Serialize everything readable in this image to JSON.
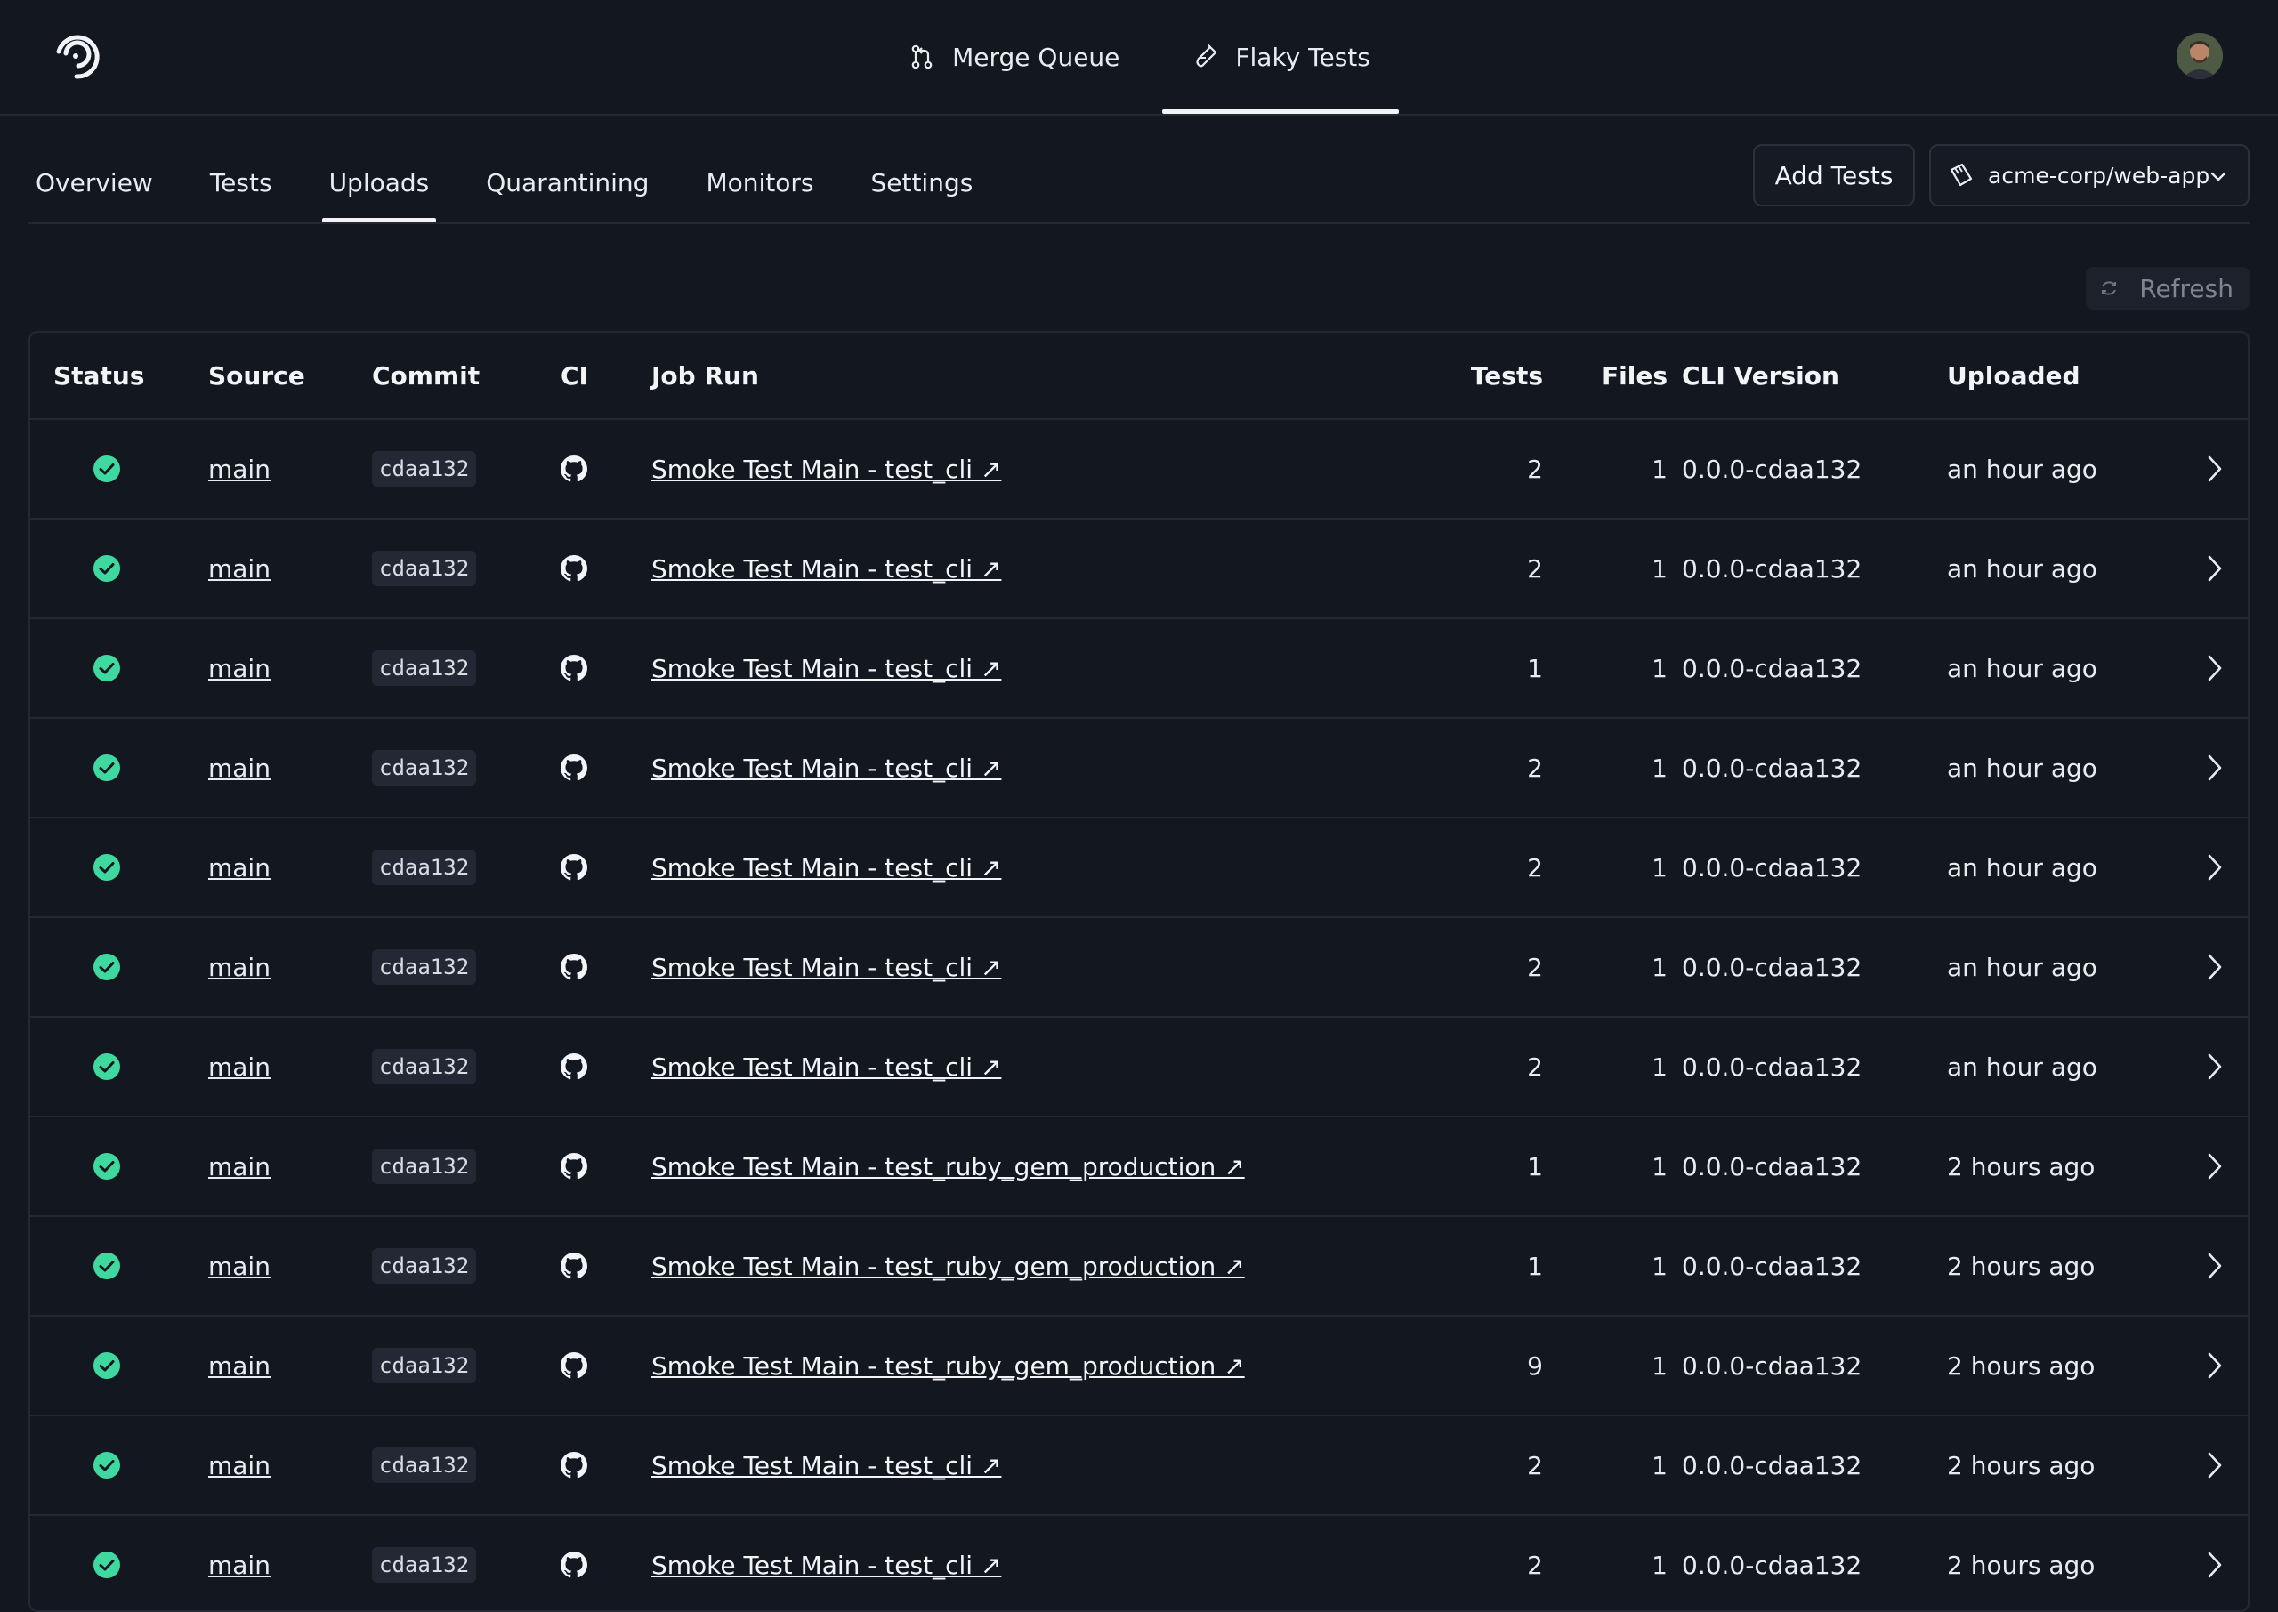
{
  "topnav": {
    "items": [
      {
        "label": "Merge Queue",
        "icon": "merge-icon",
        "active": false
      },
      {
        "label": "Flaky Tests",
        "icon": "test-tube-icon",
        "active": true
      }
    ]
  },
  "subnav": {
    "tabs": [
      {
        "label": "Overview"
      },
      {
        "label": "Tests"
      },
      {
        "label": "Uploads"
      },
      {
        "label": "Quarantining"
      },
      {
        "label": "Monitors"
      },
      {
        "label": "Settings"
      }
    ],
    "active_tab": "Uploads",
    "add_tests_label": "Add Tests",
    "repo_label": "acme-corp/web-app"
  },
  "refresh_label": "Refresh",
  "table": {
    "headers": {
      "status": "Status",
      "source": "Source",
      "commit": "Commit",
      "ci": "CI",
      "job_run": "Job Run",
      "tests": "Tests",
      "files": "Files",
      "cli_version": "CLI Version",
      "uploaded": "Uploaded"
    },
    "rows": [
      {
        "source": "main",
        "commit": "cdaa132",
        "job_run": "Smoke Test Main - test_cli ↗",
        "tests": "2",
        "files": "1",
        "cli_version": "0.0.0-cdaa132",
        "uploaded": "an hour ago"
      },
      {
        "source": "main",
        "commit": "cdaa132",
        "job_run": "Smoke Test Main - test_cli ↗",
        "tests": "2",
        "files": "1",
        "cli_version": "0.0.0-cdaa132",
        "uploaded": "an hour ago"
      },
      {
        "source": "main",
        "commit": "cdaa132",
        "job_run": "Smoke Test Main - test_cli ↗",
        "tests": "1",
        "files": "1",
        "cli_version": "0.0.0-cdaa132",
        "uploaded": "an hour ago"
      },
      {
        "source": "main",
        "commit": "cdaa132",
        "job_run": "Smoke Test Main - test_cli ↗",
        "tests": "2",
        "files": "1",
        "cli_version": "0.0.0-cdaa132",
        "uploaded": "an hour ago"
      },
      {
        "source": "main",
        "commit": "cdaa132",
        "job_run": "Smoke Test Main - test_cli ↗",
        "tests": "2",
        "files": "1",
        "cli_version": "0.0.0-cdaa132",
        "uploaded": "an hour ago"
      },
      {
        "source": "main",
        "commit": "cdaa132",
        "job_run": "Smoke Test Main - test_cli ↗",
        "tests": "2",
        "files": "1",
        "cli_version": "0.0.0-cdaa132",
        "uploaded": "an hour ago"
      },
      {
        "source": "main",
        "commit": "cdaa132",
        "job_run": "Smoke Test Main - test_cli ↗",
        "tests": "2",
        "files": "1",
        "cli_version": "0.0.0-cdaa132",
        "uploaded": "an hour ago"
      },
      {
        "source": "main",
        "commit": "cdaa132",
        "job_run": "Smoke Test Main - test_ruby_gem_production ↗",
        "tests": "1",
        "files": "1",
        "cli_version": "0.0.0-cdaa132",
        "uploaded": "2 hours ago"
      },
      {
        "source": "main",
        "commit": "cdaa132",
        "job_run": "Smoke Test Main - test_ruby_gem_production ↗",
        "tests": "1",
        "files": "1",
        "cli_version": "0.0.0-cdaa132",
        "uploaded": "2 hours ago"
      },
      {
        "source": "main",
        "commit": "cdaa132",
        "job_run": "Smoke Test Main - test_ruby_gem_production ↗",
        "tests": "9",
        "files": "1",
        "cli_version": "0.0.0-cdaa132",
        "uploaded": "2 hours ago"
      },
      {
        "source": "main",
        "commit": "cdaa132",
        "job_run": "Smoke Test Main - test_cli ↗",
        "tests": "2",
        "files": "1",
        "cli_version": "0.0.0-cdaa132",
        "uploaded": "2 hours ago"
      },
      {
        "source": "main",
        "commit": "cdaa132",
        "job_run": "Smoke Test Main - test_cli ↗",
        "tests": "2",
        "files": "1",
        "cli_version": "0.0.0-cdaa132",
        "uploaded": "2 hours ago"
      }
    ]
  },
  "colors": {
    "background": "#131720",
    "success": "#3fd9a0",
    "border": "#232833"
  }
}
